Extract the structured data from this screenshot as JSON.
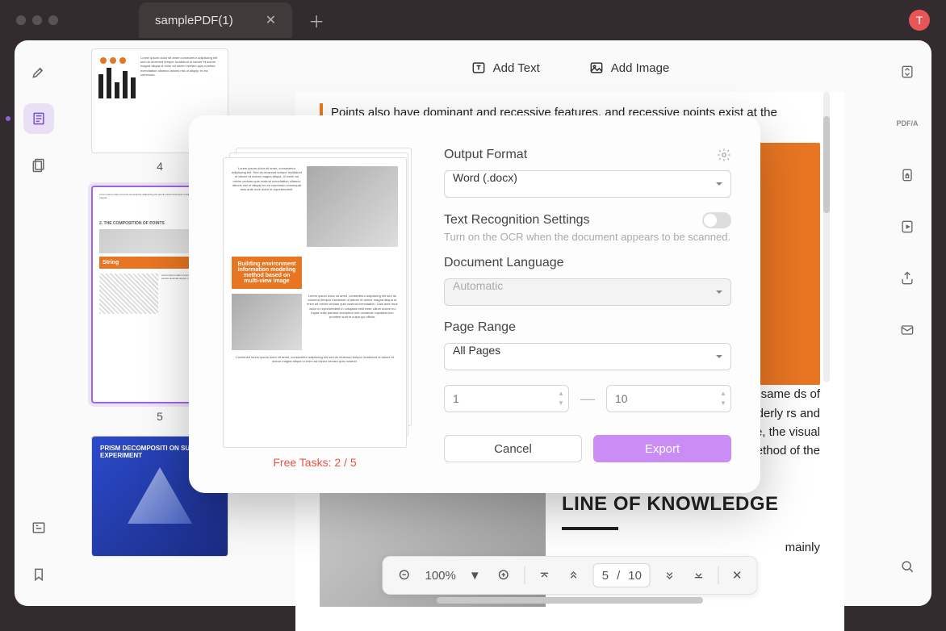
{
  "titlebar": {
    "tab_title": "samplePDF(1)",
    "avatar_letter": "T"
  },
  "toolbar": {
    "add_text": "Add Text",
    "add_image": "Add Image"
  },
  "thumbnails": {
    "num4": "4",
    "num5": "5",
    "t5_string": "String",
    "t6_title": "PRISM DECOMPOSITI ON SUNLIGHT EXPERIMENT"
  },
  "document": {
    "para1": "Points also have dominant and recessive features, and recessive points exist at the",
    "para2_tail": "ea, position or m, or the same ds of graphics in e rich and orderly rs and form a rm an overall erefore, the visual on method of the",
    "heading": "LINE OF KNOWLEDGE",
    "para3_tail": "mainly"
  },
  "pagebar": {
    "zoom": "100%",
    "current": "5",
    "sep": "/",
    "total": "10"
  },
  "modal": {
    "free_tasks": "Free Tasks: 2 / 5",
    "preview_caption": "Building environment information modeling method based on multi-view image",
    "output_format_label": "Output Format",
    "output_format_value": "Word (.docx)",
    "text_recognition_label": "Text Recognition Settings",
    "text_recognition_hint": "Turn on the OCR when the document appears to be scanned.",
    "doc_language_label": "Document Language",
    "doc_language_value": "Automatic",
    "page_range_label": "Page Range",
    "page_range_value": "All Pages",
    "range_from": "1",
    "range_to": "10",
    "cancel": "Cancel",
    "export": "Export"
  }
}
